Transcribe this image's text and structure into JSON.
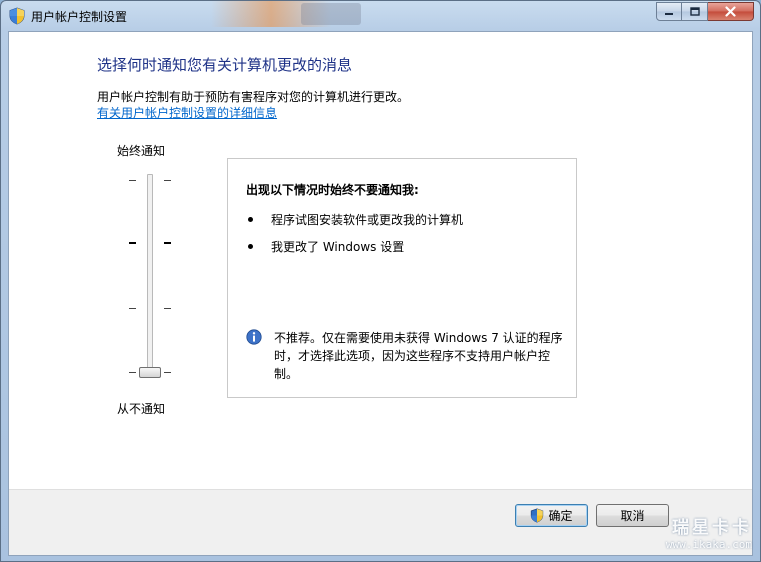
{
  "window": {
    "title": "用户帐户控制设置"
  },
  "main": {
    "heading": "选择何时通知您有关计算机更改的消息",
    "description": "用户帐户控制有助于预防有害程序对您的计算机进行更改。",
    "link": "有关用户帐户控制设置的详细信息"
  },
  "slider": {
    "top_label": "始终通知",
    "bottom_label": "从不通知",
    "levels": 4,
    "selected_level": 1
  },
  "info": {
    "title": "出现以下情况时始终不要通知我:",
    "bullets": [
      "程序试图安装软件或更改我的计算机",
      "我更改了 Windows 设置"
    ],
    "note": "不推荐。仅在需要使用未获得 Windows 7 认证的程序时，才选择此选项，因为这些程序不支持用户帐户控制。"
  },
  "footer": {
    "ok_label": "确定",
    "cancel_label": "取消"
  },
  "watermark": {
    "line1": "瑞星卡卡",
    "line2": "www.ikaka.com"
  },
  "colors": {
    "heading": "#1e3287",
    "link": "#0066cc",
    "window_frame": "#b7cde6"
  },
  "icons": {
    "title": "uac-shield-icon",
    "info": "info-icon",
    "ok_button": "uac-shield-icon"
  }
}
